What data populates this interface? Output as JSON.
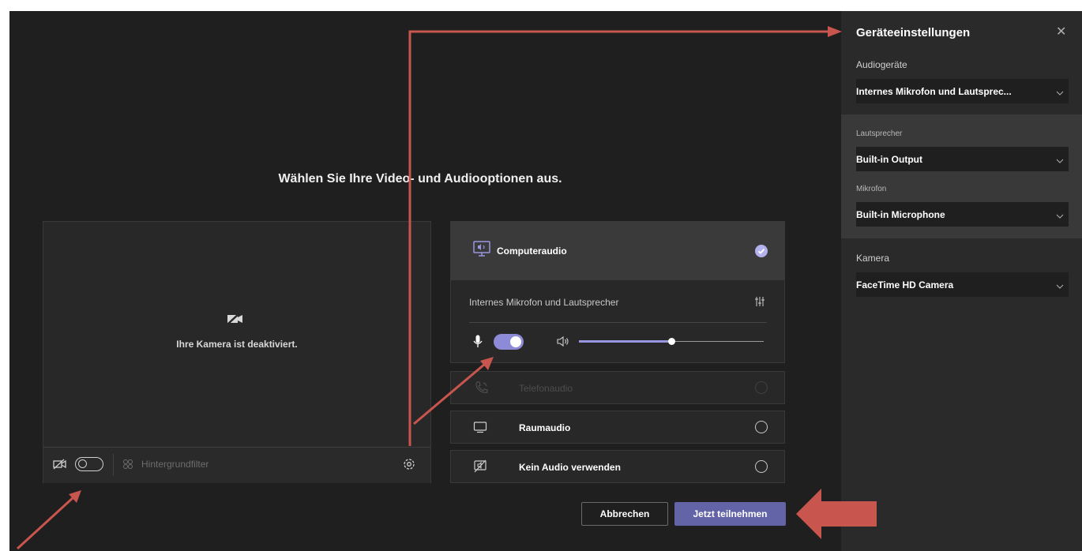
{
  "main": {
    "heading": "Wählen Sie Ihre Video- und Audiooptionen aus."
  },
  "camera": {
    "off_text": "Ihre Kamera ist deaktiviert.",
    "background_filter_label": "Hintergrundfilter"
  },
  "audio": {
    "computer_audio_label": "Computeraudio",
    "device_name": "Internes Mikrofon und Lautsprecher",
    "volume_level": 0.5,
    "options": [
      {
        "label": "Telefonaudio",
        "disabled": true
      },
      {
        "label": "Raumaudio",
        "disabled": false
      },
      {
        "label": "Kein Audio verwenden",
        "disabled": false
      }
    ]
  },
  "actions": {
    "cancel_label": "Abbrechen",
    "join_label": "Jetzt teilnehmen"
  },
  "settings": {
    "title": "Geräteeinstellungen",
    "close_symbol": "✕",
    "audio_devices_label": "Audiogeräte",
    "audio_devices_value": "Internes Mikrofon und Lautsprec...",
    "speaker_label": "Lautsprecher",
    "speaker_value": "Built-in Output",
    "mic_label": "Mikrofon",
    "mic_value": "Built-in Microphone",
    "camera_label": "Kamera",
    "camera_value": "FaceTime HD Camera"
  },
  "colors": {
    "accent": "#6264a7",
    "toggle_on": "#8d8ad7",
    "annotation_arrow": "#c9554f"
  }
}
